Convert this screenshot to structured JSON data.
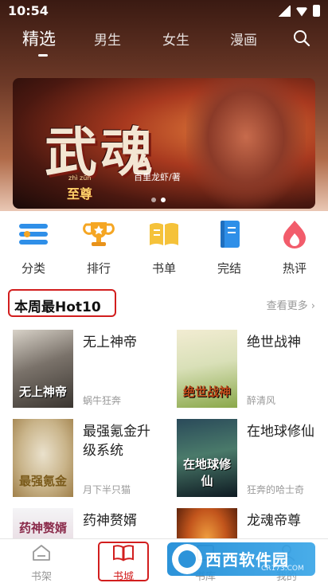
{
  "status_bar": {
    "time": "10:54"
  },
  "top_nav": {
    "tabs": [
      {
        "label": "精选",
        "active": true
      },
      {
        "label": "男生",
        "active": false
      },
      {
        "label": "女生",
        "active": false
      },
      {
        "label": "漫画",
        "active": false
      }
    ]
  },
  "banner": {
    "title": "武魂",
    "subtitle": "至尊",
    "pinyin": "zhì zūn",
    "author": "百里龙虾/著",
    "page_count": 2,
    "active_page": 2
  },
  "categories": [
    {
      "label": "分类",
      "icon": "list-icon",
      "color": "#2f8fe8"
    },
    {
      "label": "排行",
      "icon": "trophy-icon",
      "color": "#f5a623"
    },
    {
      "label": "书单",
      "icon": "open-book-icon",
      "color": "#f5c23a"
    },
    {
      "label": "完结",
      "icon": "bookmark-book-icon",
      "color": "#2f8fe8"
    },
    {
      "label": "热评",
      "icon": "flame-icon",
      "color": "#f25c6b"
    }
  ],
  "hot_section": {
    "title": "本周最Hot10",
    "more_label": "查看更多"
  },
  "books": [
    {
      "title": "无上神帝",
      "author": "蜗牛狂奔",
      "cover_text": "无上神帝",
      "cover_colors": [
        "#d8d2c8",
        "#3a3530"
      ]
    },
    {
      "title": "绝世战神",
      "author": "醉清风",
      "cover_text": "绝世战神",
      "cover_colors": [
        "#f2ecd2",
        "#8aa84a"
      ]
    },
    {
      "title": "最强氪金升级系统",
      "author": "月下半只猫",
      "cover_text": "最强氪金",
      "cover_colors": [
        "#eae1cc",
        "#a0804a"
      ]
    },
    {
      "title": "在地球修仙",
      "author": "狂奔的哈士奇",
      "cover_text": "在地球修仙",
      "cover_colors": [
        "#2a4a5a",
        "#0e1a22"
      ]
    },
    {
      "title": "药神赘婿",
      "author": "",
      "cover_text": "药神赘婿",
      "cover_colors": [
        "#f4f4f6",
        "#8a2a4a"
      ]
    },
    {
      "title": "龙魂帝尊",
      "author": "",
      "cover_text": "",
      "cover_colors": [
        "#c2551c",
        "#3a1206"
      ]
    }
  ],
  "tabbar": {
    "tabs": [
      {
        "label": "书架",
        "icon": "bookshelf-icon",
        "active": false
      },
      {
        "label": "书城",
        "icon": "book-city-icon",
        "active": true
      },
      {
        "label": "书库",
        "icon": "library-icon",
        "active": false
      },
      {
        "label": "我的",
        "icon": "user-icon",
        "active": false
      }
    ]
  },
  "watermark": {
    "text": "西西软件园",
    "url": "CR173.COM"
  },
  "colors": {
    "accent": "#d21e1e",
    "hero_top": "#3a1a12"
  }
}
